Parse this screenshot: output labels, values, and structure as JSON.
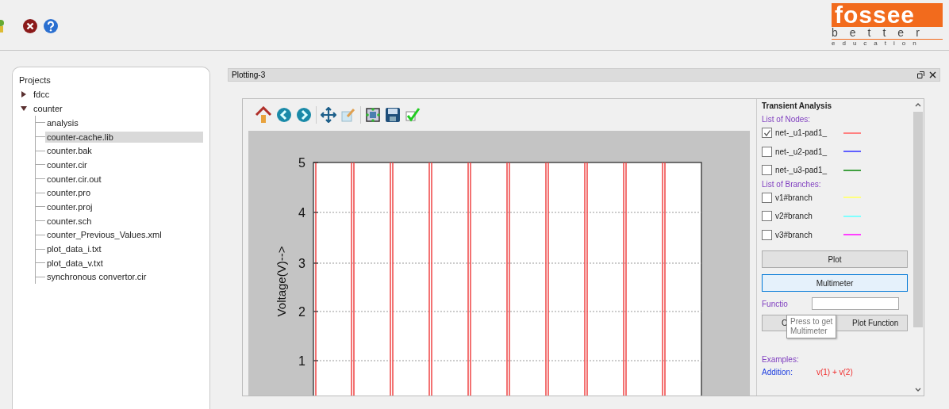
{
  "logo": {
    "title": "fossee",
    "line_2": "better",
    "line_3": "education"
  },
  "projects": {
    "title": "Projects",
    "items": [
      {
        "name": "fdcc",
        "expanded": false,
        "selected": false
      },
      {
        "name": "counter",
        "expanded": true,
        "selected": false,
        "children": [
          {
            "name": "analysis",
            "selected": false
          },
          {
            "name": "counter-cache.lib",
            "selected": true
          },
          {
            "name": "counter.bak",
            "selected": false
          },
          {
            "name": "counter.cir",
            "selected": false
          },
          {
            "name": "counter.cir.out",
            "selected": false
          },
          {
            "name": "counter.pro",
            "selected": false
          },
          {
            "name": "counter.proj",
            "selected": false
          },
          {
            "name": "counter.sch",
            "selected": false
          },
          {
            "name": "counter_Previous_Values.xml",
            "selected": false
          },
          {
            "name": "plot_data_i.txt",
            "selected": false
          },
          {
            "name": "plot_data_v.txt",
            "selected": false
          },
          {
            "name": "synchronous convertor.cir",
            "selected": false
          }
        ]
      }
    ]
  },
  "plot_window": {
    "title": "Plotting-3"
  },
  "plot": {
    "ylabel": "Voltage(V)-->",
    "yticks": [
      "5",
      "4",
      "3",
      "2",
      "1"
    ]
  },
  "analysis": {
    "title": "Transient Analysis",
    "nodes_label": "List of Nodes:",
    "nodes": [
      {
        "name": "net-_u1-pad1_",
        "checked": true,
        "color": "#ff8080"
      },
      {
        "name": "net-_u2-pad1_",
        "checked": false,
        "color": "#6060ff"
      },
      {
        "name": "net-_u3-pad1_",
        "checked": false,
        "color": "#40a040"
      }
    ],
    "branches_label": "List of Branches:",
    "branches": [
      {
        "name": "v1#branch",
        "checked": false,
        "color": "#ffff80"
      },
      {
        "name": "v2#branch",
        "checked": false,
        "color": "#80ffff"
      },
      {
        "name": "v3#branch",
        "checked": false,
        "color": "#ff40ff"
      }
    ],
    "buttons": [
      {
        "label": "Plot",
        "focused": false
      },
      {
        "label": "Multimeter",
        "focused": true
      }
    ],
    "function_label": "Functio",
    "small_buttons": [
      "C",
      "Plot Function"
    ],
    "examples_label": "Examples:",
    "example": {
      "name": "Addition:",
      "expression": "v(1) + v(2)"
    }
  },
  "tooltip": {
    "lines": [
      "Press to get",
      "Multimeter"
    ]
  }
}
